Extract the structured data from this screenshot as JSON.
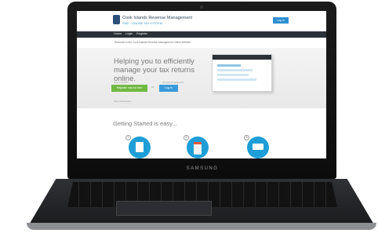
{
  "site": {
    "title": "Cook Islands Revenue Management",
    "subtitle": "RMD - ONLINE TAX SYSTEM",
    "top_login": "Log In"
  },
  "nav": {
    "items": [
      "Home",
      "Login",
      "Register"
    ]
  },
  "welcome_text": "Welcome to the Cook Islands Revenue Management Online Website",
  "hero": {
    "headline": "Helping you to efficiently manage your tax returns online.",
    "hint_register": "New to RMD?",
    "hint_login": "Already Registered?",
    "register_button": "Register now for free",
    "or_text": "or",
    "login_button": "Log In",
    "more_info": "More Information"
  },
  "getting_started": "Getting Started is easy...",
  "steps": [
    {
      "number": "1",
      "icon": "document-icon"
    },
    {
      "number": "2",
      "icon": "calendar-icon"
    },
    {
      "number": "3",
      "icon": "laptop-icon"
    }
  ],
  "device_brand": "SAMSUNG",
  "colors": {
    "nav_bg": "#2c3037",
    "primary_blue": "#2d8ecf",
    "register_green": "#6fb842",
    "step_circle": "#1e9ed6"
  }
}
